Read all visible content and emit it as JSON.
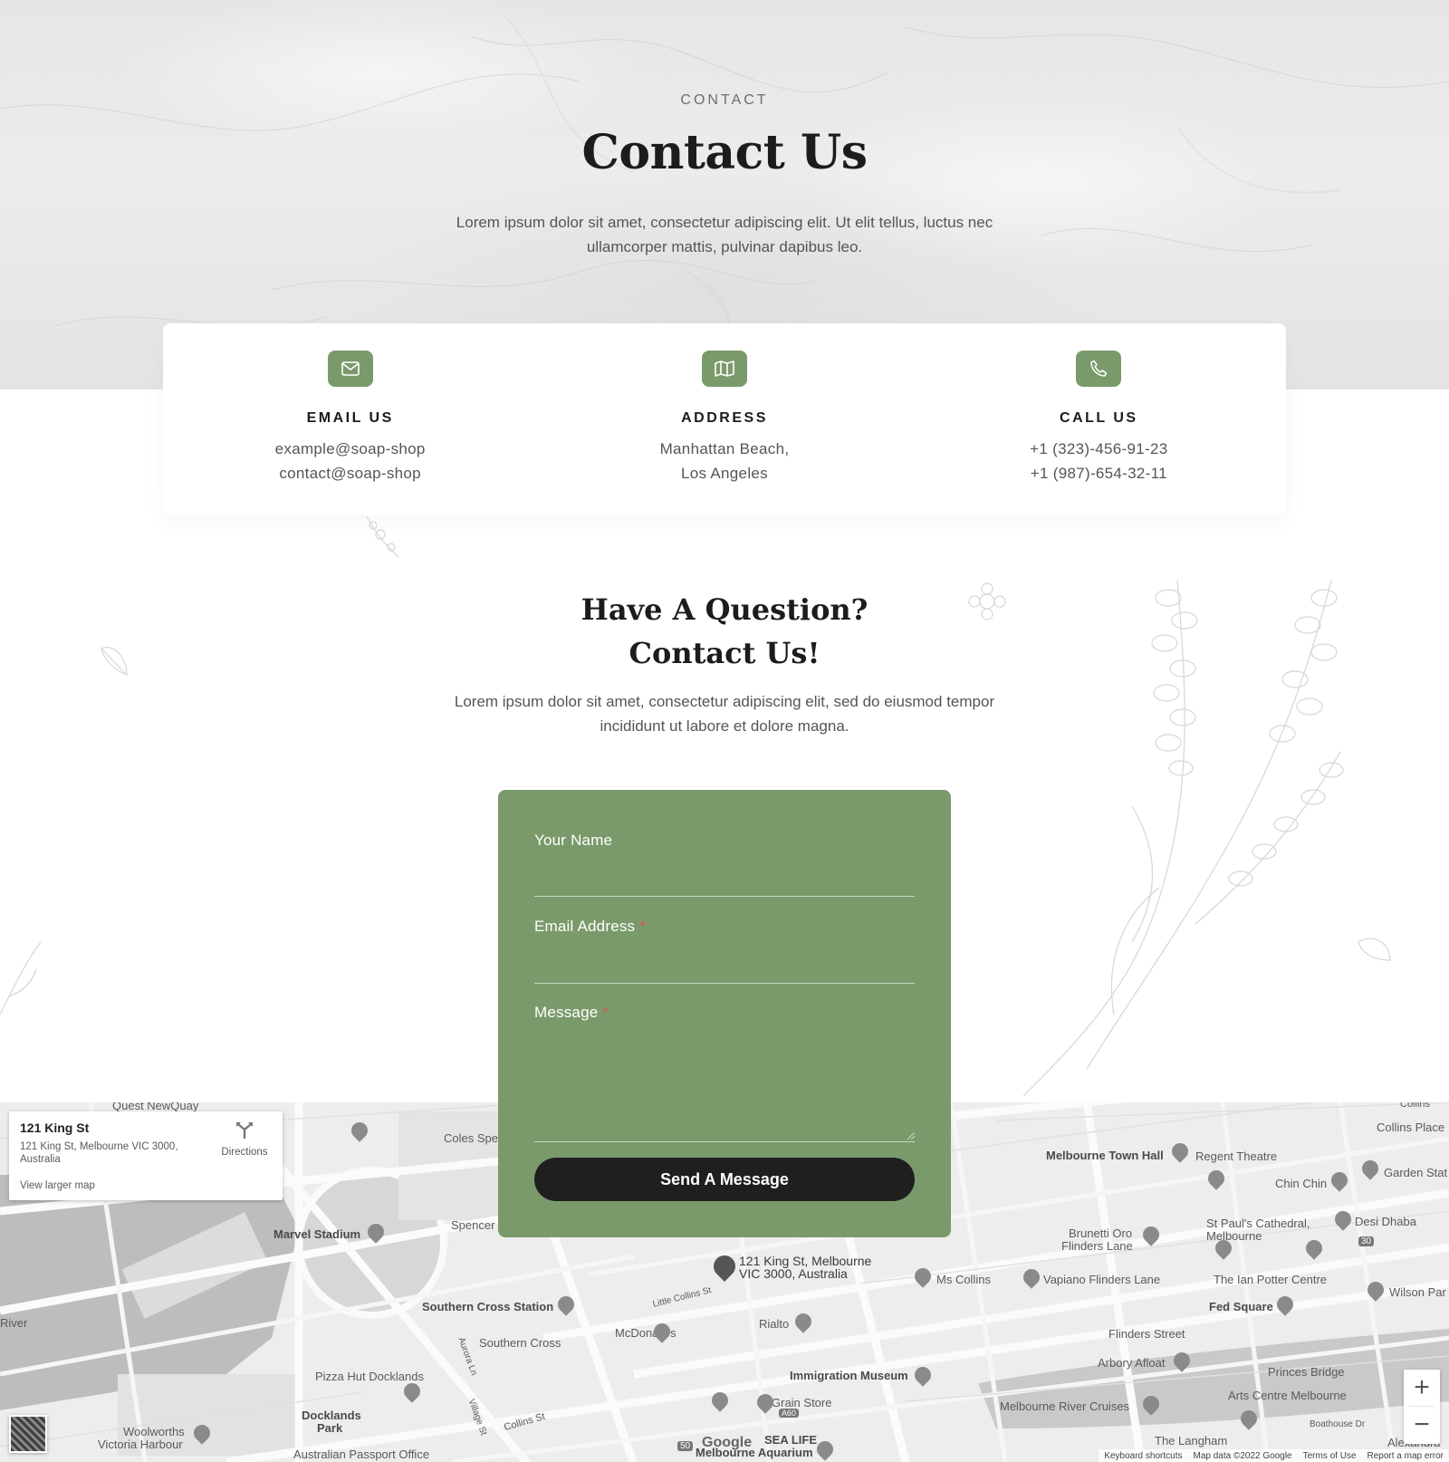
{
  "hero": {
    "eyebrow": "CONTACT",
    "title": "Contact Us",
    "description": "Lorem ipsum dolor sit amet, consectetur adipiscing elit. Ut elit tellus, luctus nec ullamcorper mattis, pulvinar dapibus leo."
  },
  "info": [
    {
      "icon": "envelope-icon",
      "title": "EMAIL US",
      "line1": "example@soap-shop",
      "line2": "contact@soap-shop"
    },
    {
      "icon": "map-icon",
      "title": "ADDRESS",
      "line1": "Manhattan Beach,",
      "line2": "Los Angeles"
    },
    {
      "icon": "phone-icon",
      "title": "CALL US",
      "line1": "+1 (323)-456-91-23",
      "line2": "+1 (987)-654-32-11"
    }
  ],
  "question": {
    "title_line1": "Have A Question?",
    "title_line2": "Contact Us!",
    "description": "Lorem ipsum dolor sit amet, consectetur adipiscing elit, sed do eiusmod tempor incididunt ut labore et dolore magna."
  },
  "form": {
    "name_label": "Your Name",
    "name_value": "",
    "email_label": "Email Address",
    "email_value": "",
    "message_label": "Message",
    "message_value": "",
    "required_mark": "*",
    "submit_label": "Send A Message"
  },
  "map": {
    "card": {
      "title": "121 King St",
      "address": "121 King St, Melbourne VIC 3000, Australia",
      "directions": "Directions",
      "larger_map": "View larger map"
    },
    "marker_label_line1": "121 King St, Melbourne",
    "marker_label_line2": "VIC 3000, Australia",
    "places": {
      "quest": "Quest NewQuay",
      "coles": "Coles Spe",
      "marvel": "Marvel Stadium",
      "spencer": "Spencer",
      "river": "River",
      "southern_station": "Southern Cross Station",
      "southern_cross": "Southern Cross",
      "mcdonalds": "McDonald's",
      "little_collins": "Little Collins St",
      "rialto": "Rialto",
      "immigration": "Immigration Museum",
      "grain": "Grain Store",
      "pizza_hut": "Pizza Hut Docklands",
      "docklands_1": "Docklands",
      "docklands_2": "Park",
      "woolworths_1": "Woolworths",
      "woolworths_2": "Victoria Harbour",
      "passport": "Australian Passport Office",
      "collins_st": "Collins St",
      "aurora": "Aurora Ln",
      "village": "Village St",
      "sealife_1": "SEA LIFE",
      "sealife_2": "Melbourne Aquarium",
      "town_hall": "Melbourne Town Hall",
      "regent": "Regent Theatre",
      "collins_place": "Collins Place",
      "chin_chin": "Chin Chin",
      "garden_state": "Garden Stat",
      "brunetti_1": "Brunetti Oro",
      "brunetti_2": "Flinders Lane",
      "st_pauls_1": "St Paul's Cathedral,",
      "st_pauls_2": "Melbourne",
      "desi": "Desi Dhaba",
      "ms_collins": "Ms Collins",
      "vapiano": "Vapiano Flinders Lane",
      "ian_potter": "The Ian Potter Centre",
      "wilson": "Wilson Par",
      "fed_square": "Fed Square",
      "flinders_street": "Flinders Street",
      "arbory": "Arbory Afloat",
      "princes_bridge": "Princes Bridge",
      "arts_centre": "Arts Centre Melbourne",
      "river_cruises": "Melbourne River Cruises",
      "langham": "The Langham",
      "alexandra": "Alexandra",
      "boathouse": "Boathouse Dr",
      "collins_top": "Collins"
    },
    "google": "Google",
    "footer": [
      "Keyboard shortcuts",
      "Map data ©2022 Google",
      "Terms of Use",
      "Report a map error"
    ],
    "zoom_in": "+",
    "zoom_out": "−",
    "road_numbers": {
      "r30": "30",
      "r50": "50",
      "a60": "A60"
    }
  },
  "colors": {
    "accent_green": "#7a9a6b",
    "button_dark": "#1f1f1f",
    "required_red": "#d9534f"
  }
}
